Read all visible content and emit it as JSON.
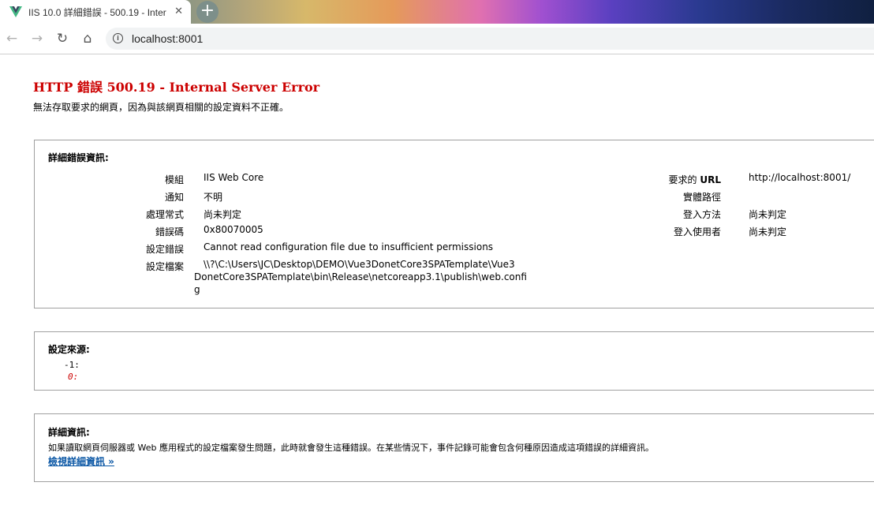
{
  "browser": {
    "tab_title": "IIS 10.0 詳細錯誤 - 500.19 - Internal Server Error",
    "tab_close": "✕",
    "new_tab": "+",
    "back": "←",
    "forward": "→",
    "reload": "↻",
    "home": "⌂",
    "info": "i",
    "url": "localhost:8001"
  },
  "page": {
    "heading": "HTTP 錯誤 500.19 - Internal Server Error",
    "subtitle": "無法存取要求的網頁，因為與該網頁相關的設定資料不正確。"
  },
  "detail_box": {
    "heading": "詳細錯誤資訊:",
    "left": [
      {
        "label": "模組",
        "value": "IIS Web Core"
      },
      {
        "label": "通知",
        "value": "不明"
      },
      {
        "label": "處理常式",
        "value": "尚未判定"
      },
      {
        "label": "錯誤碼",
        "value": "0x80070005"
      },
      {
        "label": "設定錯誤",
        "value": "Cannot read configuration file due to insufficient permissions"
      },
      {
        "label": "設定檔案",
        "value_lines": [
          "\\\\?\\C:\\Users\\JC\\Desktop\\DEMO\\Vue3DonetCore3SPATemplate\\Vue3",
          "DonetCore3SPATemplate\\bin\\Release\\netcoreapp3.1\\publish\\web.confi",
          "g"
        ]
      }
    ],
    "right": [
      {
        "label_prefix": "要求的",
        "label_bold": "URL",
        "value": "http://localhost:8001/"
      },
      {
        "label": "實體路徑",
        "value": ""
      },
      {
        "label": "登入方法",
        "value": "尚未判定"
      },
      {
        "label": "登入使用者",
        "value": "尚未判定"
      }
    ]
  },
  "config_source": {
    "heading": "設定來源:",
    "line1": "-1:",
    "line2": "0:"
  },
  "more_info": {
    "heading": "詳細資訊:",
    "text": "如果讀取網頁伺服器或 Web 應用程式的設定檔案發生問題，此時就會發生這種錯誤。在某些情況下，事件記錄可能會包含何種原因造成這項錯誤的詳細資訊。",
    "link": "檢視詳細資訊 »"
  },
  "colors": {
    "heading_red": "#cc0000",
    "link_blue": "#0b57a5"
  }
}
